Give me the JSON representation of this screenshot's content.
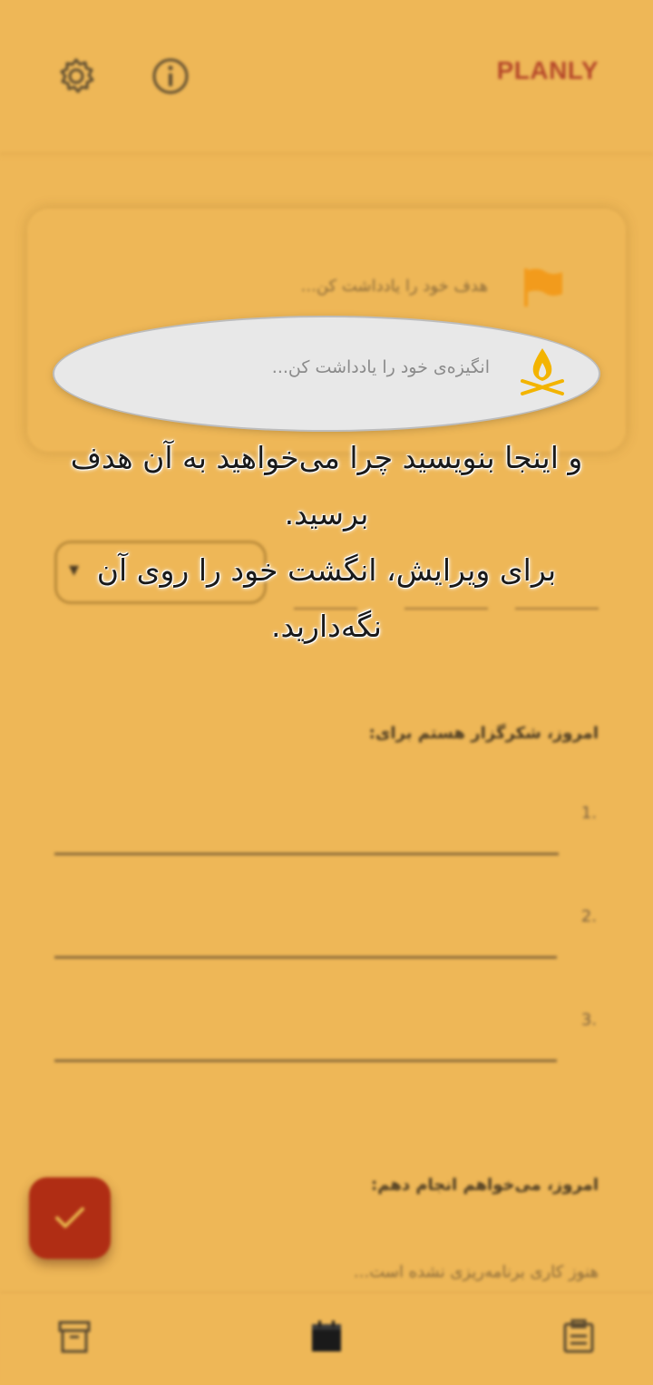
{
  "app": {
    "brand": "PLANLY"
  },
  "goal_card": {
    "goal_placeholder": "هدف خود را یادداشت کن...",
    "motivation_placeholder": "انگیزه‌ی خود را یادداشت کن..."
  },
  "gratitude": {
    "title": "امروز، شکرگزار هستم برای:",
    "items": [
      "1.",
      "2.",
      "3."
    ]
  },
  "today_tasks": {
    "title": "امروز، می‌خواهم انجام دهم:",
    "empty_text": "هنوز کاری برنامه‌ریزی نشده است..."
  },
  "tooltip": {
    "text": "و اینجا بنویسید چرا می‌خواهید به آن هدف برسید.\nبرای ویرایش، انگشت خود را روی آن نگه‌دارید."
  },
  "icons": {
    "settings": "gear-icon",
    "info": "info-icon",
    "flag": "flag-icon",
    "campfire": "campfire-icon",
    "fab": "checkmark-icon",
    "nav_left": "archive-icon",
    "nav_center": "calendar-icon",
    "nav_right": "clipboard-icon"
  },
  "colors": {
    "background": "#EEB757",
    "brand": "#B5482A",
    "fab": "#B02D14",
    "flag": "#F29B1C",
    "campfire": "#F3B400"
  }
}
